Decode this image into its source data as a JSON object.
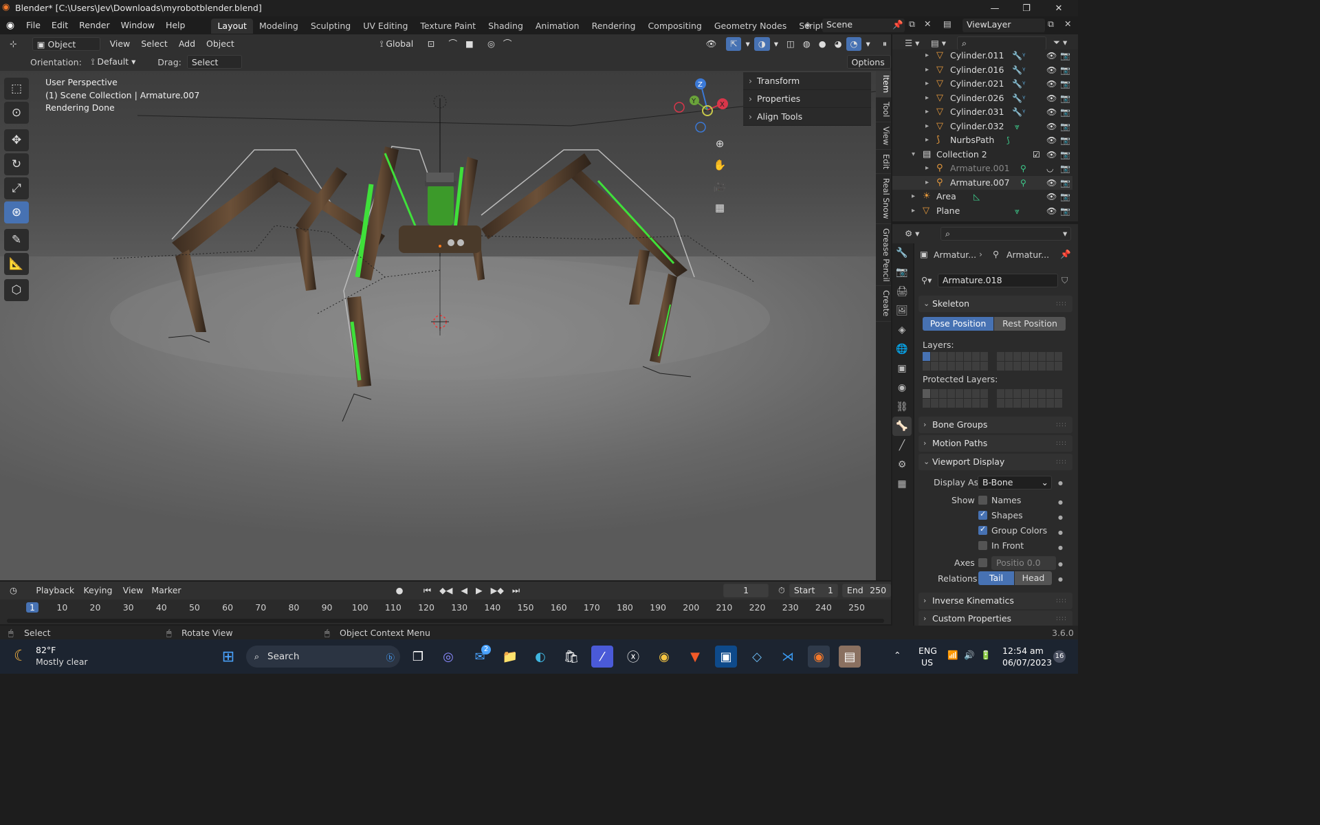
{
  "window": {
    "title": "Blender* [C:\\Users\\Jev\\Downloads\\myrobotblender.blend]"
  },
  "menu": {
    "items": [
      "File",
      "Edit",
      "Render",
      "Window",
      "Help"
    ]
  },
  "workspaces": {
    "active": "Layout",
    "tabs": [
      "Layout",
      "Modeling",
      "Sculpting",
      "UV Editing",
      "Texture Paint",
      "Shading",
      "Animation",
      "Rendering",
      "Compositing",
      "Geometry Nodes",
      "Scripting"
    ]
  },
  "scene": {
    "name": "Scene",
    "view_layer": "ViewLayer"
  },
  "viewport_header": {
    "mode": "Object Mode",
    "menus": [
      "View",
      "Select",
      "Add",
      "Object"
    ],
    "transform_orientation": "Global",
    "options_label": "Options"
  },
  "tool_settings": {
    "orientation_label": "Orientation:",
    "orientation_value": "Default",
    "drag_label": "Drag:",
    "drag_value": "Select Box"
  },
  "viewport_info": {
    "line1": "User Perspective",
    "line2": "(1) Scene Collection | Armature.007",
    "line3": "Rendering Done"
  },
  "npanel": {
    "items": [
      "Transform",
      "Properties",
      "Align Tools"
    ],
    "tabs": [
      "Item",
      "Tool",
      "View",
      "Edit",
      "Real Snow",
      "Grease Pencil",
      "Create"
    ]
  },
  "gizmo": {
    "x": "X",
    "y": "Y",
    "z": "Z"
  },
  "outliner": {
    "rows": [
      {
        "name": "Cylinder.011",
        "type": "mesh"
      },
      {
        "name": "Cylinder.016",
        "type": "mesh"
      },
      {
        "name": "Cylinder.021",
        "type": "mesh"
      },
      {
        "name": "Cylinder.026",
        "type": "mesh"
      },
      {
        "name": "Cylinder.031",
        "type": "mesh"
      },
      {
        "name": "Cylinder.032",
        "type": "mesh"
      },
      {
        "name": "NurbsPath",
        "type": "curve"
      },
      {
        "name": "Collection 2",
        "type": "collection"
      },
      {
        "name": "Armature.001",
        "type": "armature"
      },
      {
        "name": "Armature.007",
        "type": "armature"
      },
      {
        "name": "Area",
        "type": "light"
      },
      {
        "name": "Plane",
        "type": "mesh"
      }
    ]
  },
  "properties": {
    "breadcrumb_1": "Armatur...",
    "breadcrumb_2": "Armatur...",
    "datablock": "Armature.018",
    "skeleton": {
      "title": "Skeleton",
      "pose": "Pose Position",
      "rest": "Rest Position",
      "layers": "Layers:",
      "protected": "Protected Layers:"
    },
    "bone_groups": "Bone Groups",
    "motion_paths": "Motion Paths",
    "viewport_display": {
      "title": "Viewport Display",
      "display_as_label": "Display As",
      "display_as": "B-Bone",
      "show_label": "Show",
      "names": "Names",
      "shapes": "Shapes",
      "group_colors": "Group Colors",
      "in_front": "In Front",
      "axes_label": "Axes",
      "axes_field": "Positio",
      "axes_value": "0.0",
      "relations_label": "Relations",
      "tail": "Tail",
      "head": "Head"
    },
    "ik": "Inverse Kinematics",
    "custom": "Custom Properties"
  },
  "timeline": {
    "menus": [
      "Playback",
      "Keying",
      "View",
      "Marker"
    ],
    "current_frame": "1",
    "start_label": "Start",
    "start": "1",
    "end_label": "End",
    "end": "250",
    "ticks": [
      "1",
      "10",
      "20",
      "30",
      "40",
      "50",
      "60",
      "70",
      "80",
      "90",
      "100",
      "110",
      "120",
      "130",
      "140",
      "150",
      "160",
      "170",
      "180",
      "190",
      "200",
      "210",
      "220",
      "230",
      "240",
      "250"
    ]
  },
  "statusbar": {
    "select": "Select",
    "rotate": "Rotate View",
    "context": "Object Context Menu",
    "version": "3.6.0"
  },
  "taskbar": {
    "temp": "82°F",
    "weather": "Mostly clear",
    "search": "Search",
    "lang1": "ENG",
    "lang2": "US",
    "time": "12:54 am",
    "date": "06/07/2023",
    "mail_badge": "2",
    "notif": "16"
  },
  "colors": {
    "accent": "#4772b3",
    "glow": "#3fe03a"
  }
}
